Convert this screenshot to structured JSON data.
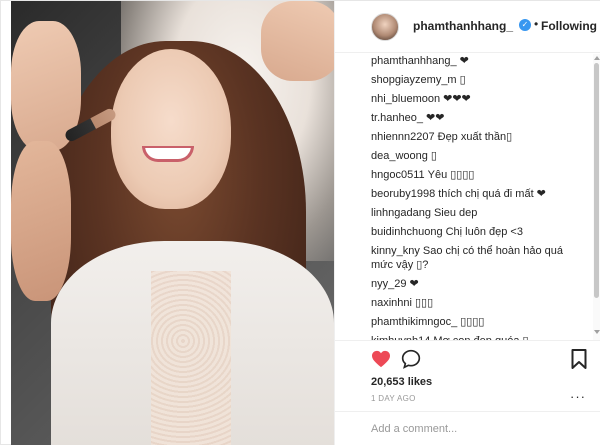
{
  "post": {
    "username": "phamthanhhang_",
    "follow_status": "Following",
    "separator": "•",
    "verified_glyph": "✓",
    "likes": "20,653 likes",
    "time_ago": "1 DAY AGO",
    "more_glyph": "···",
    "add_comment_placeholder": "Add a comment...",
    "icons": {
      "heart": "heart-icon",
      "comment": "comment-icon",
      "bookmark": "bookmark-icon",
      "verified": "verified-badge-icon"
    },
    "colors": {
      "heart": "#ed4956",
      "verified": "#3897f0",
      "link": "#262626"
    }
  },
  "comments": [
    {
      "user": "phamthanhhang_",
      "text": "❤"
    },
    {
      "user": "shopgiayzemy_m",
      "text": "▯"
    },
    {
      "user": "nhi_bluemoon",
      "text": "❤❤❤"
    },
    {
      "user": "tr.hanheo_",
      "text": "❤❤"
    },
    {
      "user": "nhiennn2207",
      "text": "Đẹp xuất thần▯"
    },
    {
      "user": "dea_woong",
      "text": "▯"
    },
    {
      "user": "hngoc0511",
      "text": "Yêu ▯▯▯▯"
    },
    {
      "user": "beoruby1998",
      "text": "thích chị quá đi mất ❤"
    },
    {
      "user": "linhngadang",
      "text": "Sieu dep"
    },
    {
      "user": "buidinhchuong",
      "text": "Chị luôn đẹp <3"
    },
    {
      "user": "kinny_kny",
      "text": "Sao chị có thể hoàn hảo quá mức vậy ▯?"
    },
    {
      "user": "nyy_29",
      "text": "❤"
    },
    {
      "user": "naxinhni",
      "text": "▯▯▯"
    },
    {
      "user": "phamthikimngoc_",
      "text": "▯▯▯▯"
    },
    {
      "user": "kimhuynh14",
      "text": "Mơ con đẹp quóa ▯"
    }
  ]
}
